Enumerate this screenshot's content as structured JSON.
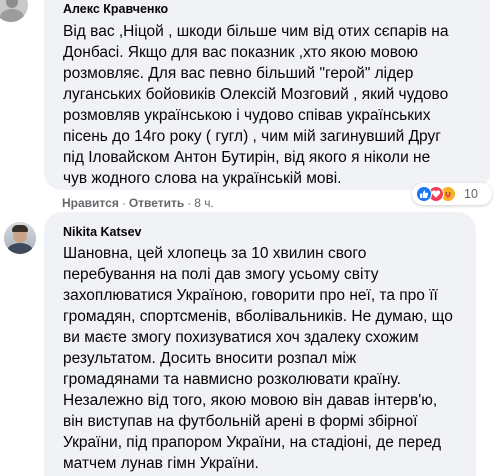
{
  "comments": [
    {
      "author": "Алекс Кравченко",
      "lines": [
        "Від вас ,Ніцой , шкоди більше чим від отих сєпарів на",
        "Донбасі. Якщо для вас показник ,хто якою мовою",
        "розмовляє. Для вас певно більший \"герой\" лідер",
        "луганських бойовиків Олексій Мозговий , який чудово",
        "розмовляв українською і чудово співав українських",
        "пісень до 14го року ( гугл) , чим мій загинувший Друг",
        "під Іловайском Антон Бутирін, від якого я ніколи не",
        "чув жодного слова на українській мові."
      ],
      "actions": {
        "like": "Нравится",
        "reply": "Ответить",
        "time": "8 ч."
      },
      "reactions": {
        "icons": [
          "like-icon",
          "love-icon",
          "care-icon"
        ],
        "count": "10"
      }
    },
    {
      "author": "Nikita Katsev",
      "lines": [
        "Шановна, цей хлопець за 10 хвилин свого",
        "перебування на полі дав змогу усьому світу",
        "захоплюватися Україною, говорити про неї, та про її",
        "громадян, спортсменів, вболівальників. Не думаю, що",
        "ви маєте змогу похизуватися хоч здалеку схожим",
        "результатом. Досить вносити розпал між",
        "громадянами та навмисно розколювати країну.",
        "Незалежно від того, якою мовою він давав інтерв'ю,",
        "він виступав на футбольній арені в формі збірної",
        "України, під прапором України, на стадіоні, де перед",
        "матчем лунав гімн України."
      ]
    }
  ],
  "colors": {
    "bubble": "#f0f2f5",
    "meta": "#65676b",
    "text": "#050505",
    "like": "#1877f2",
    "love": "#f33e58",
    "care": "#f7b125"
  }
}
